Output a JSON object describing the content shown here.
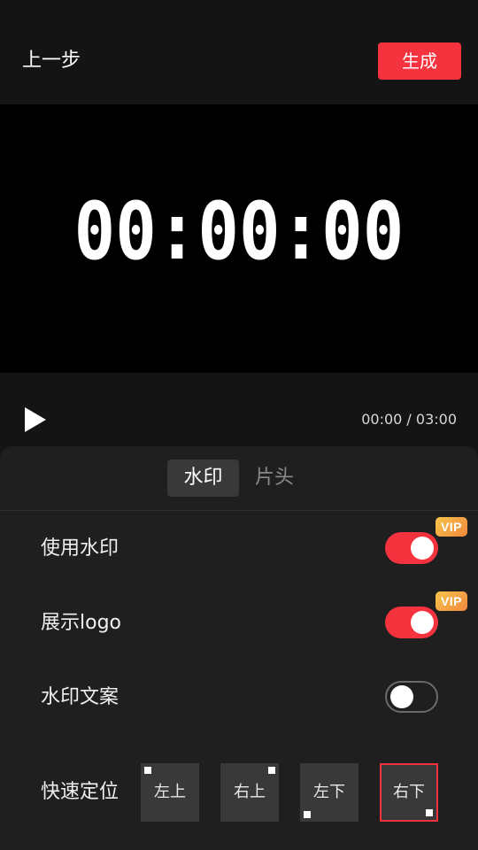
{
  "header": {
    "back_label": "上一步",
    "generate_label": "生成"
  },
  "preview": {
    "timecode": "00:00:00"
  },
  "playback": {
    "time_display": "00:00 / 03:00"
  },
  "tabs": [
    {
      "label": "水印",
      "active": true
    },
    {
      "label": "片头",
      "active": false
    }
  ],
  "settings": {
    "use_watermark": {
      "label": "使用水印",
      "enabled": true,
      "badge": "VIP"
    },
    "show_logo": {
      "label": "展示logo",
      "enabled": true,
      "badge": "VIP"
    },
    "watermark_text": {
      "label": "水印文案",
      "enabled": false
    },
    "quick_position": {
      "label": "快速定位",
      "options": [
        "左上",
        "右上",
        "左下",
        "右下"
      ],
      "selected": "右下"
    }
  },
  "colors": {
    "accent": "#f5333f",
    "background": "#141414",
    "panel": "#1f1f1f",
    "vip_gradient_start": "#f7c44a",
    "vip_gradient_end": "#f0883e"
  },
  "icons": {
    "play": "play-icon"
  }
}
